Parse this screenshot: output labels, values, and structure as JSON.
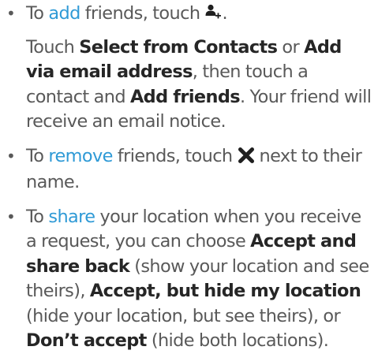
{
  "items": [
    {
      "prefix": "To ",
      "keyword": "add",
      "middle": " friends, touch ",
      "icon": "add-friend-icon",
      "suffix": ".",
      "detail": {
        "t1": "Touch ",
        "b1": "Select from Contacts",
        "t2": " or ",
        "b2": "Add via email address",
        "t3": ", then touch a contact and ",
        "b3": "Add friends",
        "t4": ". Your friend will receive an email notice."
      }
    },
    {
      "prefix": "To ",
      "keyword": "remove",
      "middle": " friends, touch ",
      "icon": "remove-x-icon",
      "suffix": " next to their name."
    },
    {
      "prefix": "To ",
      "keyword": "share",
      "t1": " your location when you receive a request, you can choose ",
      "b1": "Accept and share back",
      "t2": " (show your location and see theirs), ",
      "b2": "Accept, but hide my location",
      "t3": " (hide your location, but see theirs), or ",
      "b3": "Don’t accept",
      "t4": " (hide both locations)."
    }
  ],
  "colors": {
    "text": "#595959",
    "bold": "#262626",
    "keyword": "#2f9ad6"
  }
}
